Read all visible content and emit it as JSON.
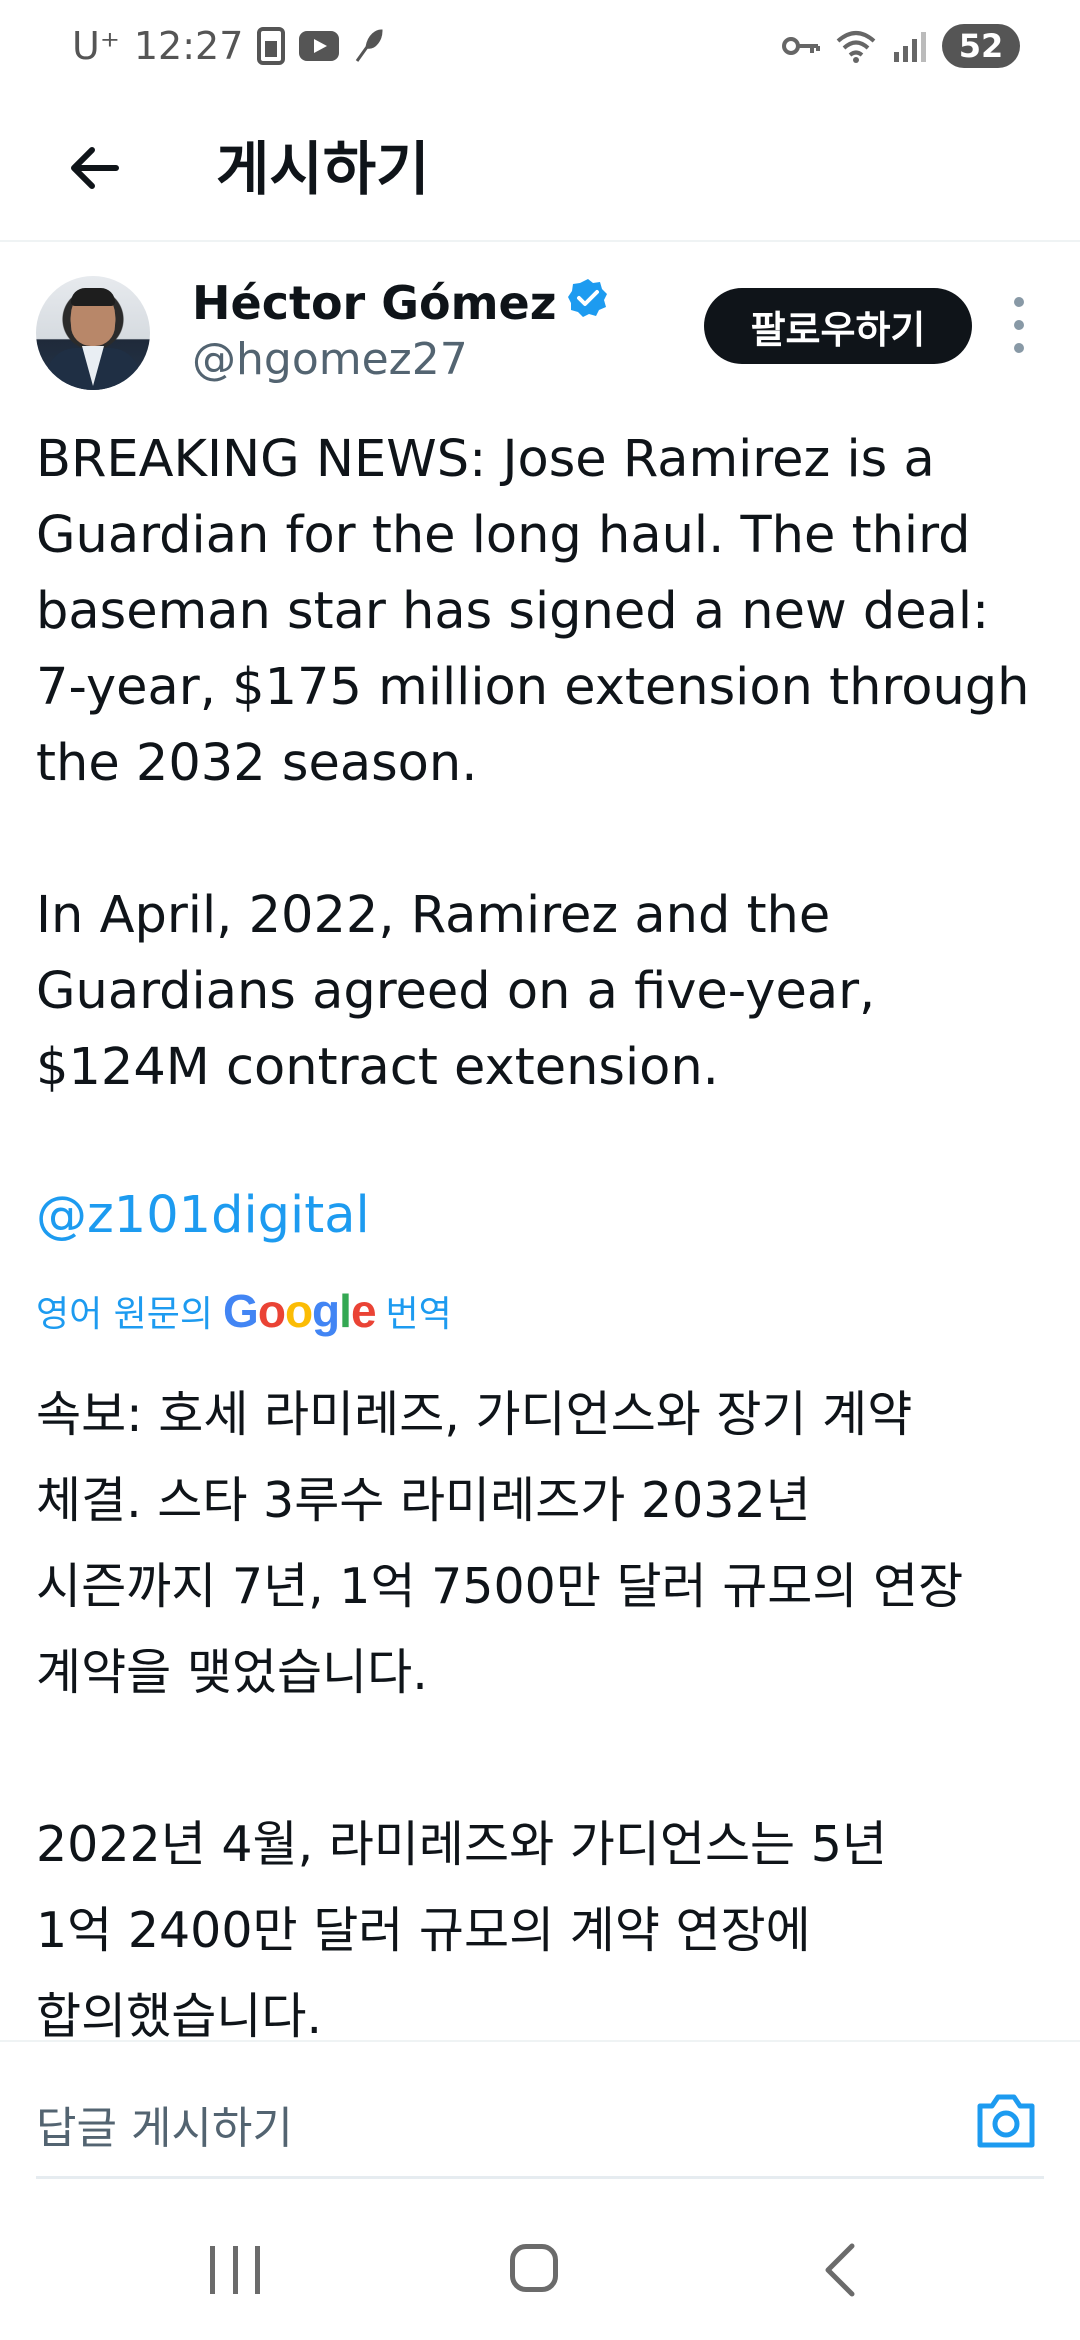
{
  "status_bar": {
    "carrier": "U⁺",
    "time": "12:27",
    "battery": "52",
    "icons": [
      "sim-card-icon",
      "youtube-icon",
      "feather-icon",
      "vpn-key-icon",
      "wifi-icon",
      "signal-icon"
    ]
  },
  "header": {
    "back_icon": "arrow-left-icon",
    "title": "게시하기"
  },
  "author": {
    "name": "Héctor Gómez",
    "verified_icon": "verified-badge-icon",
    "handle": "@hgomez27",
    "follow_label": "팔로우하기",
    "more_icon": "more-vertical-icon"
  },
  "tweet": {
    "text": "BREAKING NEWS: Jose Ramirez is a\nGuardian for the long haul. The third\nbaseman star has signed a new deal:\n7-year, $175 million extension through\nthe 2032 season.\n\nIn April, 2022, Ramirez and the\nGuardians agreed on a five-year,\n$124M contract extension.",
    "mention": "@z101digital",
    "translate_prefix": "영어 원문의",
    "translate_brand": "Google",
    "translate_suffix": "번역",
    "translated_text": "속보: 호세 라미레즈, 가디언스와 장기 계약\n체결. 스타 3루수 라미레즈가 2032년\n시즌까지 7년, 1억 7500만 달러 규모의 연장\n계약을 맺었습니다.\n\n2022년 4월, 라미레즈와 가디언스는 5년\n1억 2400만 달러 규모의 계약 연장에\n합의했습니다."
  },
  "reply": {
    "placeholder": "답글 게시하기",
    "camera_icon": "camera-icon"
  },
  "nav_bar": {
    "icons": [
      "recent-apps-icon",
      "home-icon",
      "back-icon"
    ]
  },
  "colors": {
    "accent": "#1d9bf0",
    "text": "#0f1419",
    "secondary": "#536471",
    "follow_bg": "#0f1419"
  }
}
